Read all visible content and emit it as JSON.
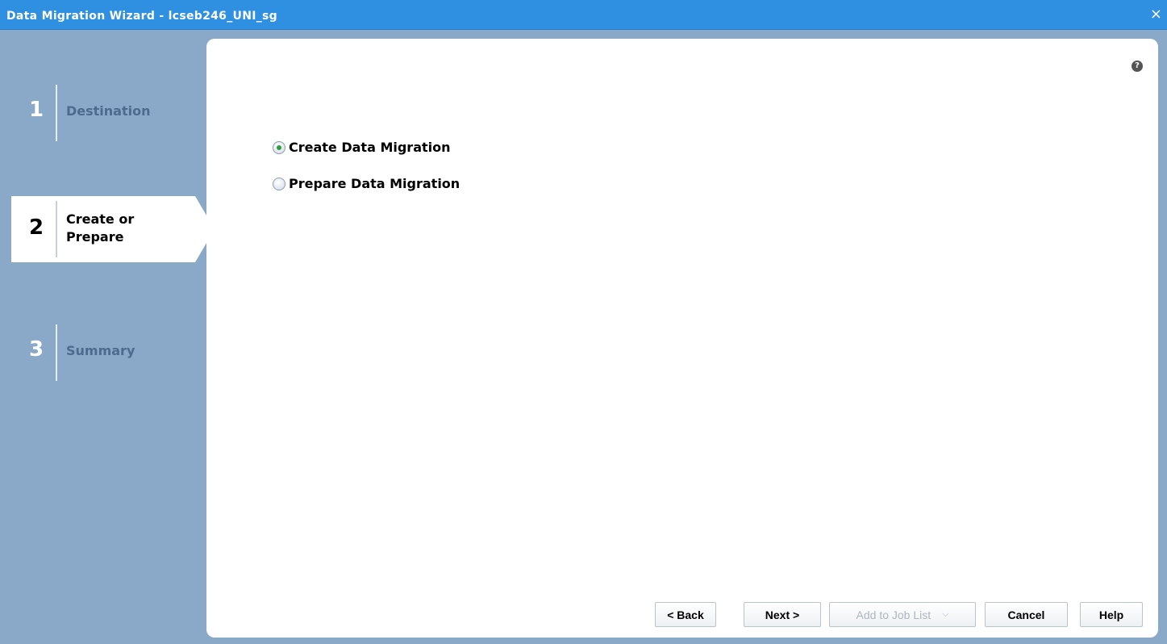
{
  "window": {
    "title": "Data Migration Wizard - lcseb246_UNI_sg",
    "close_glyph": "×"
  },
  "steps": [
    {
      "number": "1",
      "label": "Destination",
      "state": "done"
    },
    {
      "number": "2",
      "label_line1": "Create or",
      "label_line2": "Prepare",
      "state": "active"
    },
    {
      "number": "3",
      "label": "Summary",
      "state": "pending"
    }
  ],
  "panel": {
    "help_icon": "?",
    "options": [
      {
        "label": "Create Data Migration",
        "checked": true
      },
      {
        "label": "Prepare Data Migration",
        "checked": false
      }
    ]
  },
  "buttons": {
    "back": "< Back",
    "next": "Next >",
    "add_to_job_list": "Add to Job List",
    "add_to_job_list_chevron": "⌵",
    "cancel": "Cancel",
    "help": "Help"
  },
  "colors": {
    "titlebar": "#2f8fe0",
    "sidebar": "#8aa8c8",
    "panel": "#ffffff",
    "radio_selected": "#2e9e3a"
  }
}
